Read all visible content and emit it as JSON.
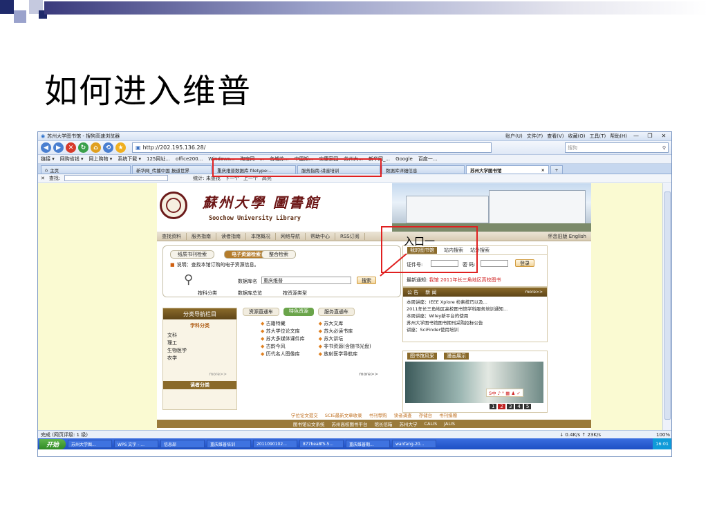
{
  "slide": {
    "title": "如何进入维普"
  },
  "browser": {
    "window_title": "苏州大学图书馆 - 搜狗高速浏览器",
    "menu": [
      "账户(U)",
      "文件(F)",
      "查看(V)",
      "收藏(O)",
      "工具(T)",
      "帮助(H)"
    ],
    "address": "http://202.195.136.28/",
    "search_placeholder": "搜狗",
    "nav_links": [
      "苏州大学图书馆",
      "翻译",
      "热点"
    ],
    "favorites": [
      "链接 ▾",
      "网购省钱 ▾",
      "网上购物 ▾",
      "系统下载 ▾",
      "125网址...",
      "office200...",
      "Windows...",
      "淘宝网 - ...",
      "名城苏...",
      "中国知...",
      "安康家园",
      "苏州大...",
      "新华网_...",
      "Google",
      "百度一..."
    ],
    "tabs": [
      {
        "label": "主页",
        "active": false
      },
      {
        "label": "新华网_传播中国 报道世界",
        "active": false
      },
      {
        "label": "重庆维普数据库 filetype:...",
        "active": false
      },
      {
        "label": "服务指南-讲座培训",
        "active": false
      },
      {
        "label": "数据库详细信息",
        "active": false
      },
      {
        "label": "苏州大学图书馆",
        "active": true
      }
    ],
    "find_label": "查找:",
    "find_status": "统计: 未查找",
    "find_next": "下一个",
    "find_prev": "上一个",
    "find_highlight": "高亮",
    "status_left": "完成 (网页评级: 1 级)",
    "status_right": "↓ 0.4K/s ↑ 23K/s",
    "zoom": "100%"
  },
  "library": {
    "name_cn": "蘇州大學 圖書館",
    "name_en": "Soochow University Library",
    "nav": [
      "查找资料",
      "服务指南",
      "读者指南",
      "本馆概况",
      "网络导航",
      "帮助中心",
      "RSS订阅"
    ],
    "nav_right": "怀念旧版  English",
    "search_tabs": [
      "纸质书刊检索",
      "电子资源检索",
      "整合检索"
    ],
    "search_note": "说明：查找本馆订购的电子资源信息。",
    "db_label": "数据库名",
    "db_value": "重庆维普",
    "search_button": "搜索",
    "search_links": [
      "按科分类",
      "数据库总览",
      "按资源类型"
    ],
    "mylib_tabs": [
      "我的图书馆",
      "站内搜索",
      "站外搜索"
    ],
    "card_label": "证件号:",
    "pwd_label": "密 码:",
    "login_button": "登录",
    "notice_label": "最新通知:",
    "notice_text": "我馆    2011年长三角地区高校图书",
    "news_tabs": [
      "公 告",
      "新 闻"
    ],
    "news_more": "more>>",
    "news": [
      "本周讲座：IEEE Xplore 检索技巧以及...",
      "2011年长三角地区高校图书馆学科服务培训通知...",
      "本周讲座：Wiley新平台的使用",
      "苏州大学图书馆图书期刊采购招标公告",
      "讲座：SciFinder使用培训"
    ],
    "nav_panel_title": "分类导航栏目",
    "subject_title": "学科分类",
    "subjects": [
      "文科",
      "理工",
      "生物医学",
      "农学"
    ],
    "subject_more": "more>>",
    "reader_title": "读者分类",
    "resource_tabs": [
      "资源直通车",
      "特色资源",
      "服务直通车"
    ],
    "resources_left": [
      "古籍特藏",
      "苏大学位论文库",
      "苏大多媒体课件库",
      "古韵今风",
      "历代名人图像库"
    ],
    "resources_right": [
      "苏大文库",
      "苏大必读书库",
      "苏大讲坛",
      "非书资源(含随书光盘)",
      "放射医学导航库"
    ],
    "resources_more": "more>>",
    "gallery_tabs": [
      "图书馆风采",
      "漫画展示"
    ],
    "pages": [
      "1",
      "2",
      "3",
      "4",
      "5"
    ],
    "footer_links": [
      "学位论文提交",
      "SCIE最新文章收录",
      "书刊荐购",
      "读者调查",
      "存储台",
      "书刊捐赠"
    ],
    "footer_links2": [
      "图书馆公文系统",
      "苏州高校图书平台",
      "馆长信箱",
      "苏州大学",
      "CALIS",
      "JALIS"
    ],
    "annotation": "入口一"
  },
  "taskbar": {
    "start": "开始",
    "tasks": [
      "苏州大学图...",
      "WPS 文字 - ...",
      "信息部",
      "重庆维普培训",
      "2011090102...",
      "877bea8f5-5...",
      "重庆维普期...",
      "wanfang-20..."
    ],
    "clock": "16:01"
  }
}
